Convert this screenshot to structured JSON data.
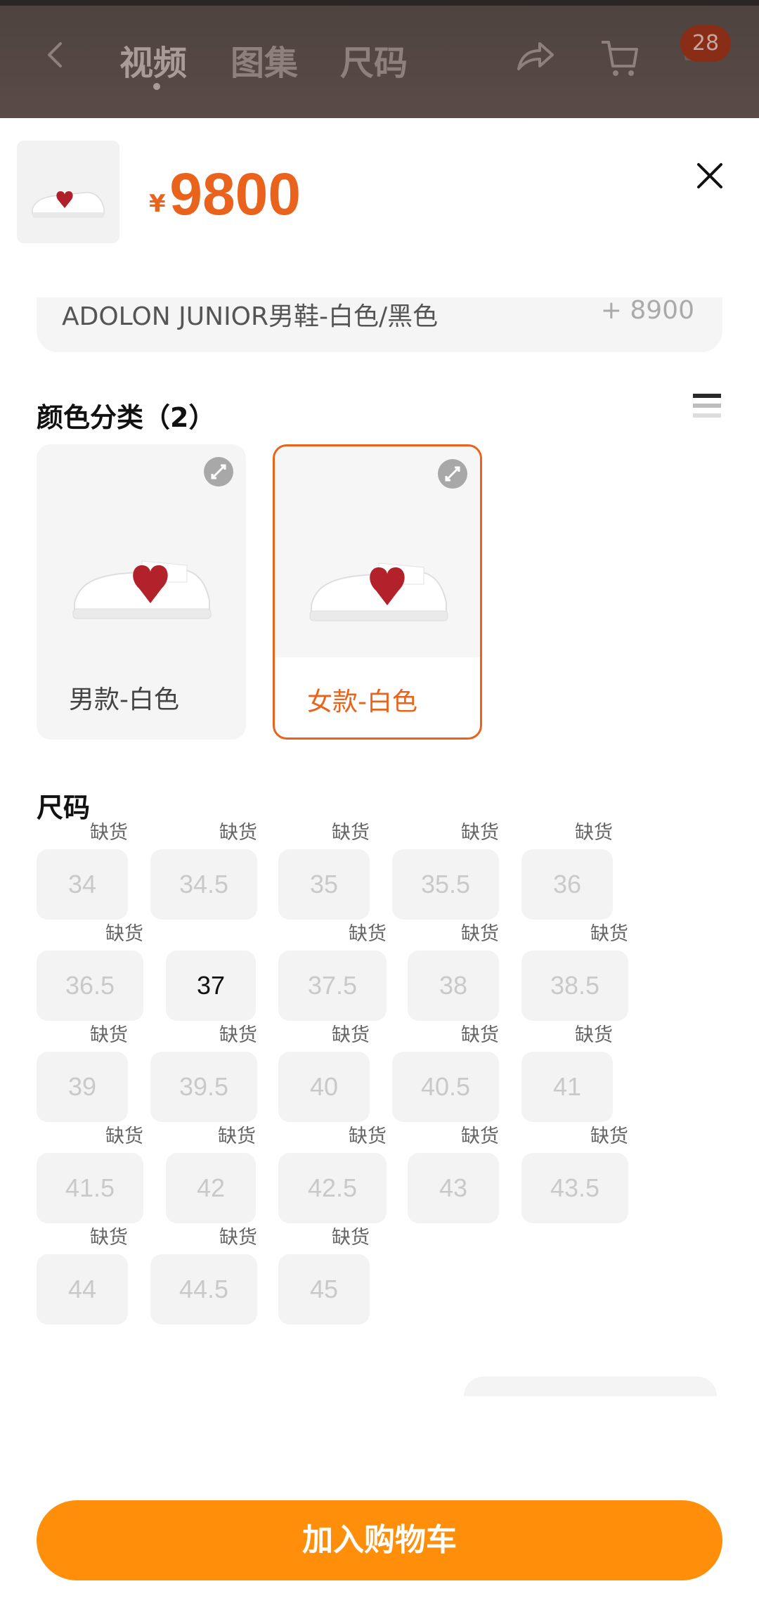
{
  "header": {
    "tabs": [
      {
        "label": "视频"
      },
      {
        "label": "图集"
      },
      {
        "label": "尺码"
      }
    ],
    "cart_badge": "28"
  },
  "sheet": {
    "price_currency": "¥",
    "price_value": "9800",
    "prev_option": {
      "title": "ADOLON JUNIOR男鞋-白色/黑色",
      "price": "+ 8900"
    },
    "color_section_title": "颜色分类（2）",
    "colors": [
      {
        "label": "男款-白色",
        "selected": false
      },
      {
        "label": "女款-白色",
        "selected": true
      }
    ],
    "size_section_title": "尺码",
    "out_of_stock_label": "缺货",
    "sizes": [
      {
        "size": "34",
        "available": false
      },
      {
        "size": "34.5",
        "available": false
      },
      {
        "size": "35",
        "available": false
      },
      {
        "size": "35.5",
        "available": false
      },
      {
        "size": "36",
        "available": false
      },
      {
        "size": "36.5",
        "available": false
      },
      {
        "size": "37",
        "available": true
      },
      {
        "size": "37.5",
        "available": false
      },
      {
        "size": "38",
        "available": false
      },
      {
        "size": "38.5",
        "available": false
      },
      {
        "size": "39",
        "available": false
      },
      {
        "size": "39.5",
        "available": false
      },
      {
        "size": "40",
        "available": false
      },
      {
        "size": "40.5",
        "available": false
      },
      {
        "size": "41",
        "available": false
      },
      {
        "size": "41.5",
        "available": false
      },
      {
        "size": "42",
        "available": false
      },
      {
        "size": "42.5",
        "available": false
      },
      {
        "size": "43",
        "available": false
      },
      {
        "size": "43.5",
        "available": false
      },
      {
        "size": "44",
        "available": false
      },
      {
        "size": "44.5",
        "available": false
      },
      {
        "size": "45",
        "available": false
      }
    ],
    "add_to_cart_label": "加入购物车"
  },
  "colors": {
    "accent": "#e9631d",
    "button": "#ff8e0b"
  }
}
